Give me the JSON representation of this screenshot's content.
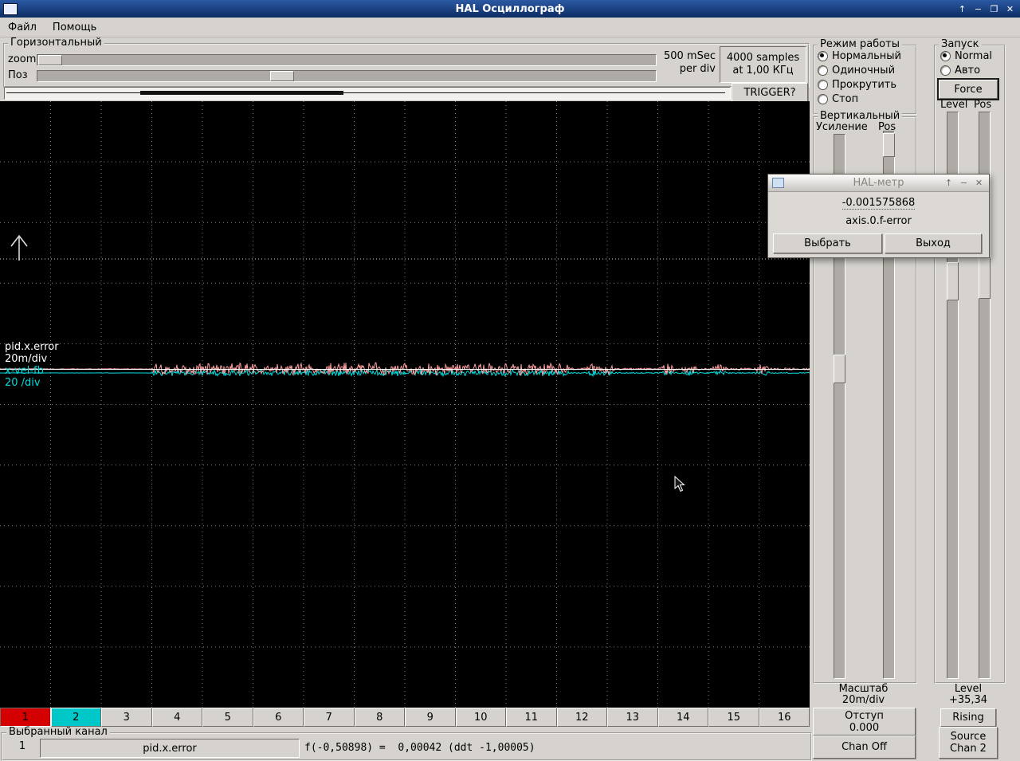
{
  "titlebar": {
    "title": "HAL Осциллограф",
    "shade_icon": "↑",
    "minimize_icon": "−",
    "maximize_icon": "❐",
    "close_icon": "✕"
  },
  "menubar": {
    "file": "Файл",
    "help": "Помощь"
  },
  "horizontal": {
    "frame_label": "Горизонтальный",
    "zoom_label": "zoom",
    "pos_label": "Поз",
    "rate_line1": "500 mSec",
    "rate_line2": "per div",
    "samples_line1": "4000 samples",
    "samples_line2": "at 1,00 КГц",
    "trigger_button": "TRIGGER?"
  },
  "scope": {
    "channel1_name": "pid.x.error",
    "channel1_scale": "20m/div",
    "channel2_name": "x-vel-fb",
    "channel2_scale": "20 /div",
    "channel1_color": "#ffffff",
    "channel2_color": "#00dcdc"
  },
  "run_mode": {
    "frame_label": "Режим работы",
    "option1": "Нормальный",
    "option2": "Одиночный",
    "option3": "Прокрутить",
    "option4": "Стоп"
  },
  "vertical": {
    "frame_label": "Вертикальный",
    "gain_label": "Усиление",
    "pos_label": "Pos",
    "scale_label": "Масштаб",
    "scale_value": "20m/div",
    "offset_label": "Отступ",
    "offset_value": "0.000",
    "chan_button": "Chan Off"
  },
  "trigger": {
    "frame_label": "Запуск",
    "option1": "Normal",
    "option2": "Авто",
    "force_button": "Force",
    "level_label": "Level",
    "pos_label": "Pos",
    "level_readout_label": "Level",
    "level_readout_value": "+35,34",
    "edge_button": "Rising",
    "source_line1": "Source",
    "source_line2": "Chan 2"
  },
  "halmeter": {
    "title": "HAL-метр",
    "shade_icon": "↑",
    "minimize_icon": "−",
    "close_icon": "✕",
    "value": "-0.001575868",
    "signal": "axis.0.f-error",
    "select_button": "Выбрать",
    "exit_button": "Выход"
  },
  "channels": {
    "labels": [
      "1",
      "2",
      "3",
      "4",
      "5",
      "6",
      "7",
      "8",
      "9",
      "10",
      "11",
      "12",
      "13",
      "14",
      "15",
      "16"
    ]
  },
  "selected_channel": {
    "frame_label": "Выбранный канал",
    "number": "1",
    "name": "pid.x.error",
    "readout": "f(-0,50898) =  0,00042 (ddt -1,00005)"
  }
}
